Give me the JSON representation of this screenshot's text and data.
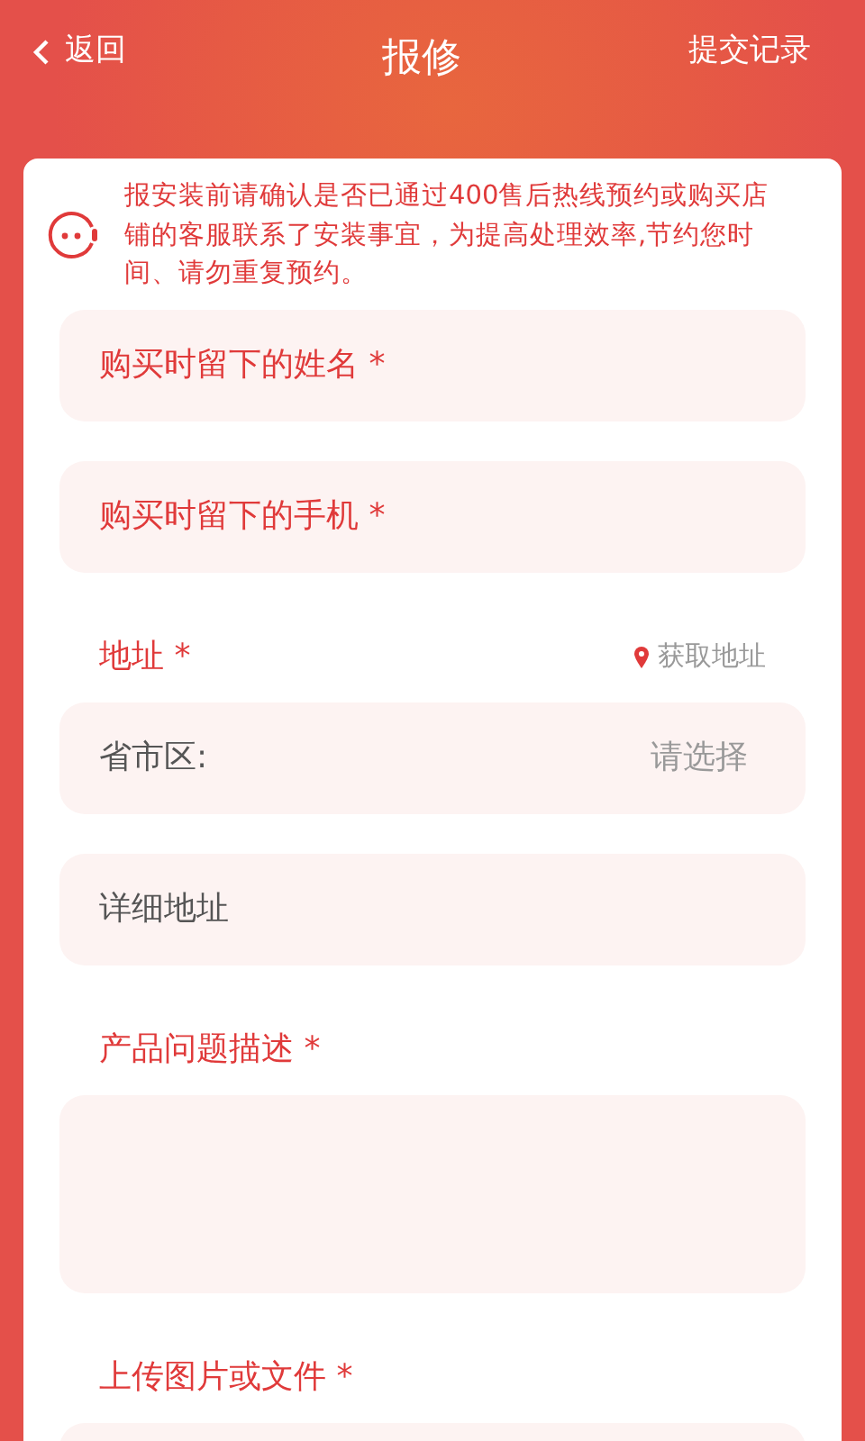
{
  "header": {
    "back": "返回",
    "title": "报修",
    "action": "提交记录"
  },
  "notice": "报安装前请确认是否已通过400售后热线预约或购买店铺的客服联系了安装事宜，为提高处理效率,节约您时间、请勿重复预约。",
  "fields": [
    {
      "kind": "input",
      "placeholder": "购买时留下的姓名 *",
      "required": true
    },
    {
      "kind": "input",
      "placeholder": "购买时留下的手机 *",
      "required": true
    },
    {
      "kind": "section",
      "label": "地址 *",
      "action": "获取地址"
    },
    {
      "kind": "select",
      "label": "省市区:",
      "value": "请选择"
    },
    {
      "kind": "input",
      "placeholder": "详细地址",
      "required": false
    },
    {
      "kind": "section",
      "label": "产品问题描述 *"
    },
    {
      "kind": "textarea"
    },
    {
      "kind": "section",
      "label": "上传图片或文件 *"
    },
    {
      "kind": "upload"
    }
  ]
}
